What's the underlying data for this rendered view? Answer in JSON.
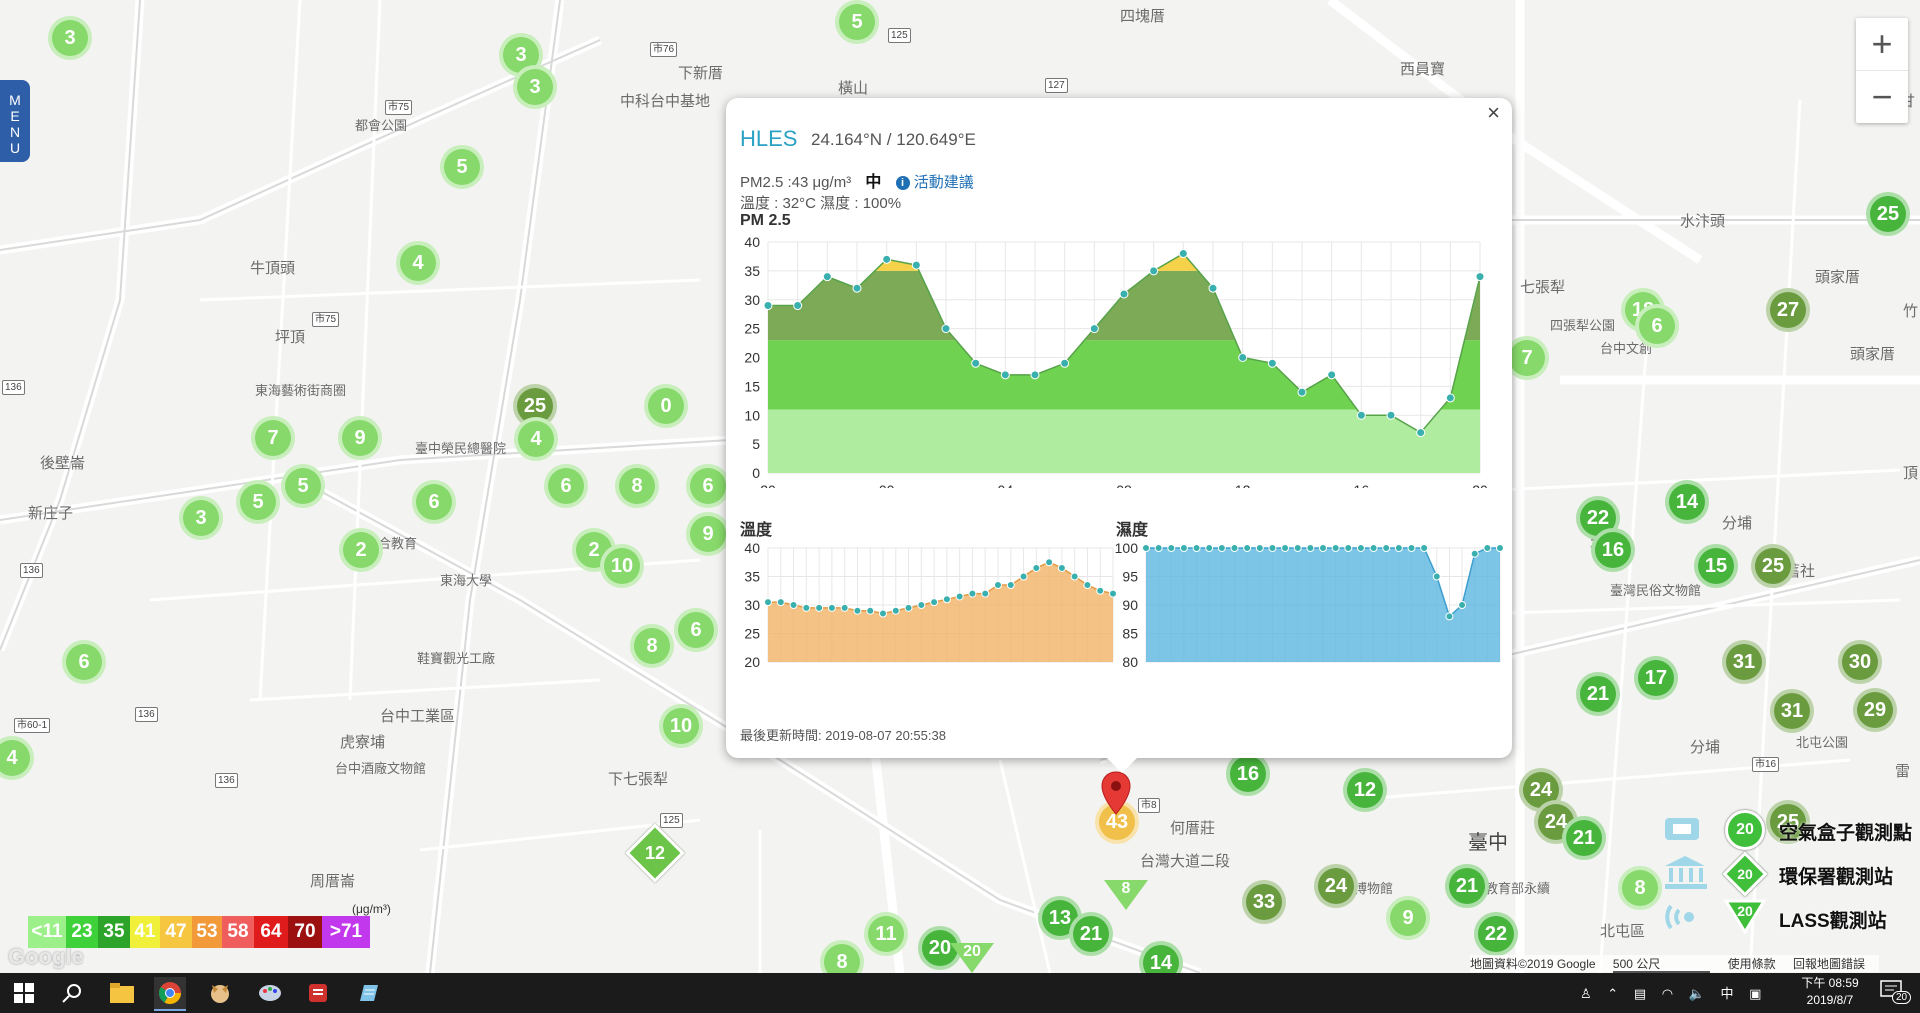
{
  "map": {
    "places": [
      "四塊厝",
      "下新厝",
      "中科台中基地",
      "橫山",
      "西員寶",
      "牛頂頭",
      "都會公園",
      "坪頂",
      "東海藝術街商圈",
      "後壁崙",
      "新庄子",
      "臺中榮民總醫院",
      "東海大學",
      "聯合教育",
      "鞋寶觀光工廠",
      "台中工業區",
      "虎寮埔",
      "台中酒廠文物館",
      "周厝崙",
      "下七張犁",
      "何厝莊",
      "臺中",
      "北屯區",
      "水汴頭",
      "頭家厝",
      "頭家厝",
      "北屯",
      "分埔",
      "舊社",
      "七張犁",
      "科學博物館",
      "北區",
      "台中文創",
      "臺灣民俗文物館",
      "北屯公園",
      "雷",
      "甘",
      "竹",
      "頂",
      "分埔",
      "四張犁公園",
      "台灣大道二段",
      "教育部永續"
    ],
    "clusters": [
      {
        "v": "3",
        "c": "lg"
      },
      {
        "v": "5",
        "c": "lg"
      },
      {
        "v": "3",
        "c": "lg"
      },
      {
        "v": "3",
        "c": "lg"
      },
      {
        "v": "5",
        "c": "lg"
      },
      {
        "v": "4",
        "c": "lg"
      },
      {
        "v": "25",
        "c": "dg"
      },
      {
        "v": "4",
        "c": "lg"
      },
      {
        "v": "0",
        "c": "lg"
      },
      {
        "v": "7",
        "c": "lg"
      },
      {
        "v": "9",
        "c": "lg"
      },
      {
        "v": "5",
        "c": "lg"
      },
      {
        "v": "5",
        "c": "lg"
      },
      {
        "v": "6",
        "c": "lg"
      },
      {
        "v": "6",
        "c": "lg"
      },
      {
        "v": "2",
        "c": "lg"
      },
      {
        "v": "8",
        "c": "lg"
      },
      {
        "v": "6",
        "c": "lg"
      },
      {
        "v": "3",
        "c": "lg"
      },
      {
        "v": "2",
        "c": "lg"
      },
      {
        "v": "10",
        "c": "lg"
      },
      {
        "v": "9",
        "c": "lg"
      },
      {
        "v": "8",
        "c": "lg"
      },
      {
        "v": "6",
        "c": "lg"
      },
      {
        "v": "6",
        "c": "lg"
      },
      {
        "v": "10",
        "c": "lg"
      },
      {
        "v": "4",
        "c": "lg"
      },
      {
        "v": "16",
        "c": "g"
      },
      {
        "v": "12",
        "c": "g"
      },
      {
        "v": "24",
        "c": "dg"
      },
      {
        "v": "24",
        "c": "dg"
      },
      {
        "v": "21",
        "c": "g"
      },
      {
        "v": "24",
        "c": "dg"
      },
      {
        "v": "33",
        "c": "dg"
      },
      {
        "v": "21",
        "c": "g"
      },
      {
        "v": "9",
        "c": "lg"
      },
      {
        "v": "22",
        "c": "g"
      },
      {
        "v": "13",
        "c": "g"
      },
      {
        "v": "21",
        "c": "g"
      },
      {
        "v": "11",
        "c": "lg"
      },
      {
        "v": "20",
        "c": "g"
      },
      {
        "v": "8",
        "c": "lg"
      },
      {
        "v": "14",
        "c": "g"
      },
      {
        "v": "43",
        "c": "or"
      },
      {
        "v": "25",
        "c": "g"
      },
      {
        "v": "18",
        "c": "lg"
      },
      {
        "v": "6",
        "c": "lg"
      },
      {
        "v": "7",
        "c": "lg"
      },
      {
        "v": "27",
        "c": "dg"
      },
      {
        "v": "22",
        "c": "g"
      },
      {
        "v": "16",
        "c": "g"
      },
      {
        "v": "14",
        "c": "g"
      },
      {
        "v": "15",
        "c": "g"
      },
      {
        "v": "25",
        "c": "dg"
      },
      {
        "v": "31",
        "c": "dg"
      },
      {
        "v": "30",
        "c": "dg"
      },
      {
        "v": "17",
        "c": "g"
      },
      {
        "v": "21",
        "c": "g"
      },
      {
        "v": "31",
        "c": "dg"
      },
      {
        "v": "29",
        "c": "dg"
      },
      {
        "v": "25",
        "c": "dg"
      },
      {
        "v": "8",
        "c": "lg"
      },
      {
        "v": "6",
        "c": "lg"
      }
    ],
    "diamond_value": "12",
    "triangles": [
      "8",
      "20"
    ]
  },
  "menu_label": "MENU",
  "zoom": {
    "in": "+",
    "out": "−"
  },
  "popup": {
    "close": "×",
    "station": "HLES",
    "coords": "24.164°N / 120.649°E",
    "pm_text": "PM2.5 :43 μg/m³",
    "level": "中",
    "advice": "活動建議",
    "temp_humidity": "溫度 : 32°C 濕度 : 100%",
    "updated": "最後更新時間: 2019-08-07 20:55:38"
  },
  "chart_data": [
    {
      "type": "area",
      "title": "PM 2.5",
      "xlabel": "",
      "ylabel": "",
      "x_tick_labels": [
        "20",
        "00",
        "04",
        "08",
        "12",
        "16",
        "20"
      ],
      "ylim": [
        0,
        40
      ],
      "y_ticks": [
        0,
        5,
        10,
        15,
        20,
        25,
        30,
        35,
        40
      ],
      "values": [
        29,
        29,
        34,
        32,
        37,
        36,
        25,
        19,
        17,
        17,
        19,
        25,
        31,
        35,
        38,
        32,
        20,
        19,
        14,
        17,
        10,
        10,
        7,
        13,
        34
      ],
      "bands": [
        {
          "upto": 11,
          "color": "#b0eca0"
        },
        {
          "upto": 23,
          "color": "#6fd250"
        },
        {
          "upto": 35,
          "color": "#7daa57"
        },
        {
          "upto": 41,
          "color": "#f6d24b"
        }
      ]
    },
    {
      "type": "area",
      "title": "溫度",
      "xlabel": "",
      "ylabel": "",
      "ylim": [
        20,
        40
      ],
      "y_ticks": [
        20,
        25,
        30,
        35,
        40
      ],
      "values": [
        30.5,
        30.5,
        30,
        29.5,
        29.5,
        29.5,
        29.5,
        29,
        29,
        28.5,
        29,
        29.5,
        30,
        30.5,
        31,
        31.5,
        32,
        32,
        33.5,
        33.5,
        35,
        36.5,
        37.5,
        36.5,
        35,
        33.5,
        32.5,
        32
      ],
      "color": "#f2b366"
    },
    {
      "type": "area",
      "title": "濕度",
      "xlabel": "",
      "ylabel": "",
      "ylim": [
        80,
        100
      ],
      "y_ticks": [
        80,
        85,
        90,
        95,
        100
      ],
      "values": [
        100,
        100,
        100,
        100,
        100,
        100,
        100,
        100,
        100,
        100,
        100,
        100,
        100,
        100,
        100,
        100,
        100,
        100,
        100,
        100,
        100,
        100,
        100,
        95,
        88,
        90,
        99,
        100,
        100
      ],
      "color": "#5bb6e0"
    }
  ],
  "legend": {
    "items": [
      {
        "label": "<11",
        "color": "#9cf08a"
      },
      {
        "label": "23",
        "color": "#3fd13a"
      },
      {
        "label": "35",
        "color": "#2ca42a"
      },
      {
        "label": "41",
        "color": "#f0f03a"
      },
      {
        "label": "47",
        "color": "#f7c640"
      },
      {
        "label": "53",
        "color": "#f29a3a"
      },
      {
        "label": "58",
        "color": "#ef5d5d"
      },
      {
        "label": "64",
        "color": "#e01b1b"
      },
      {
        "label": "70",
        "color": "#9c1010"
      },
      {
        "label": ">71",
        "color": "#c238ec"
      }
    ],
    "unit": "(μg/m³)"
  },
  "layers": {
    "airbox": "空氣盒子觀測點",
    "epa": "環保署觀測站",
    "lass": "LASS觀測站",
    "marker_value": "20"
  },
  "attribution": {
    "data": "地圖資料©2019 Google",
    "scale": "500 公尺",
    "terms": "使用條款",
    "report": "回報地圖錯誤",
    "logo": "Google"
  },
  "taskbar": {
    "time": "下午 08:59",
    "date": "2019/8/7",
    "ime": "中",
    "notifications": "20"
  }
}
